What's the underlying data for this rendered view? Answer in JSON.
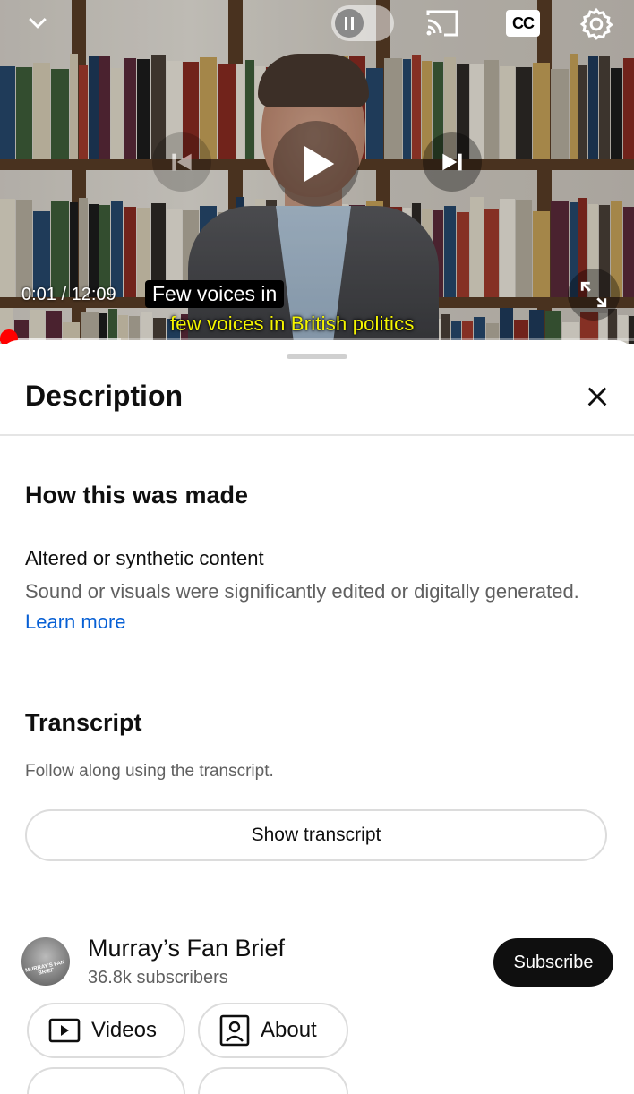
{
  "player": {
    "time": "0:01 / 12:09",
    "caption_top": "Few voices in",
    "caption_bottom": "few voices in British politics",
    "cc_label": "CC",
    "progress_fraction": 0.001,
    "buffered_fraction": 0.19,
    "icons": [
      "chevron-down-icon",
      "pause-icon",
      "cast-icon",
      "cc-icon",
      "settings-icon",
      "previous-icon",
      "play-icon",
      "next-icon",
      "fullscreen-icon"
    ]
  },
  "sheet": {
    "title": "Description",
    "how_made": {
      "heading": "How this was made",
      "label": "Altered or synthetic content",
      "text": "Sound or visuals were significantly edited or digitally generated.",
      "link": "Learn more"
    },
    "transcript": {
      "heading": "Transcript",
      "subtext": "Follow along using the transcript.",
      "button": "Show transcript"
    },
    "channel": {
      "name": "Murray’s Fan Brief",
      "subscribers": "36.8k subscribers",
      "avatar_text": "MURRAY'S FAN BRIEF",
      "subscribe": "Subscribe"
    },
    "tabs": [
      {
        "label": "Videos",
        "icon": "video-play-icon"
      },
      {
        "label": "About",
        "icon": "person-box-icon"
      }
    ]
  },
  "colors": {
    "accent_red": "#ff0000",
    "link_blue": "#065fd4",
    "caption_yellow": "#f5f500"
  }
}
